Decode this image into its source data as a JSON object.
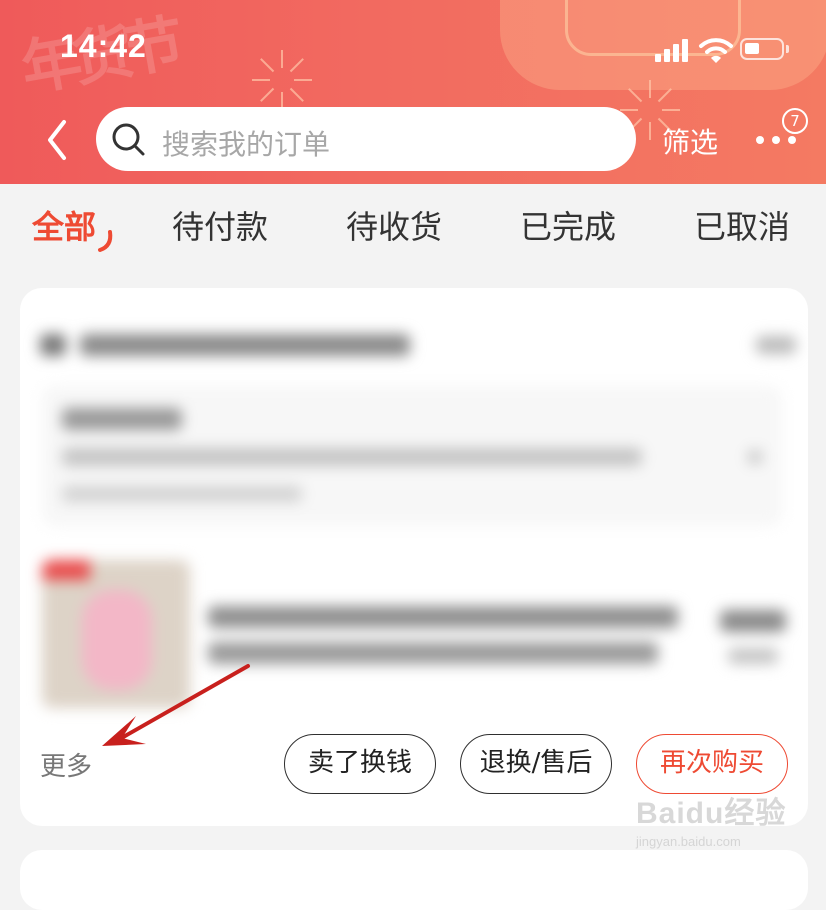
{
  "status_bar": {
    "time": "14:42"
  },
  "header": {
    "decor_text": "年货节",
    "search_placeholder": "搜索我的订单",
    "filter_label": "筛选",
    "badge_count": "7"
  },
  "tabs": [
    {
      "label": "全部",
      "active": true
    },
    {
      "label": "待付款",
      "active": false
    },
    {
      "label": "待收货",
      "active": false
    },
    {
      "label": "已完成",
      "active": false
    },
    {
      "label": "已取消",
      "active": false
    }
  ],
  "order": {
    "more_label": "更多",
    "actions": [
      "卖了换钱",
      "退换/售后",
      "再次购买"
    ]
  },
  "watermark": {
    "main": "Baidu经验",
    "sub": "jingyan.baidu.com"
  },
  "colors": {
    "accent": "#ee4a33",
    "header": "#f26a60"
  }
}
